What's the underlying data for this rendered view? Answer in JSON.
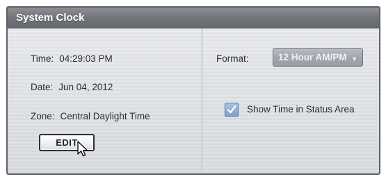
{
  "panel": {
    "title": "System Clock"
  },
  "clock": {
    "time_label": "Time:",
    "time_value": "04:29:03 PM",
    "date_label": "Date:",
    "date_value": "Jun 04, 2012",
    "zone_label": "Zone:",
    "zone_value": "Central Daylight Time",
    "edit_label": "EDIT"
  },
  "format": {
    "label": "Format:",
    "selected": "12 Hour AM/PM",
    "arrow_icon": "triangle-down-icon"
  },
  "status_area": {
    "label": "Show Time in Status Area",
    "checked": true
  },
  "icons": {
    "cursor": "arrow-pointer-icon",
    "check": "checkmark-icon"
  },
  "colors": {
    "header": "#6f7277",
    "select": "#a2a6ac",
    "checkbox": "#7da1c8"
  }
}
